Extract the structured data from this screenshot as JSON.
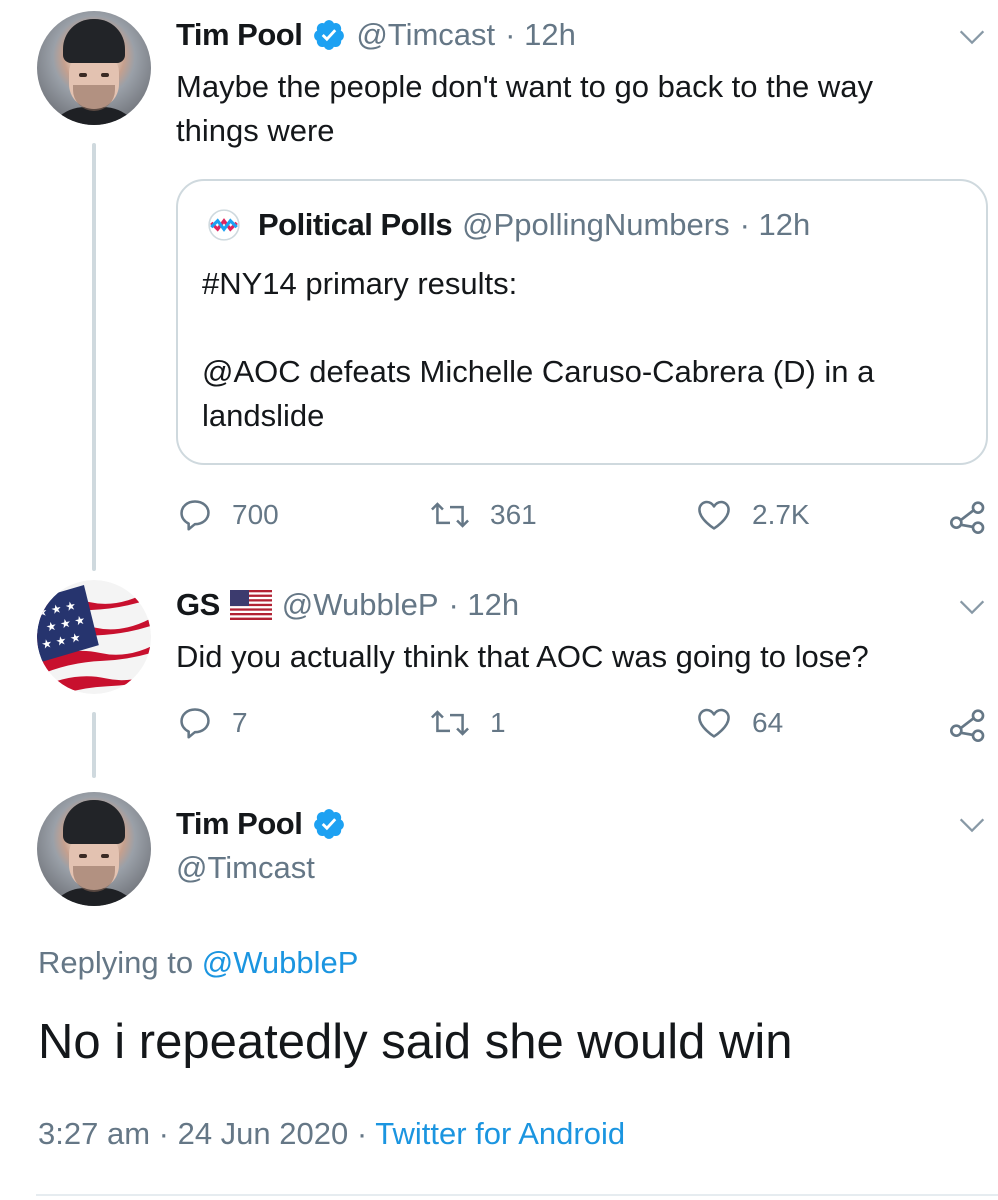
{
  "tweet1": {
    "name": "Tim Pool",
    "handle": "@Timcast",
    "time": "· 12h",
    "text_line1": "Maybe the people don't want to go back to the way",
    "text_line2": "things were",
    "quote": {
      "name": "Political Polls",
      "handle": "@PpollingNumbers",
      "time": "· 12h",
      "line1": "#NY14 primary results:",
      "line2": "@AOC defeats Michelle Caruso-Cabrera (D) in a",
      "line3": "landslide"
    },
    "replies": "700",
    "retweets": "361",
    "likes": "2.7K"
  },
  "tweet2": {
    "name": "GS",
    "handle": "@WubbleP",
    "time": "· 12h",
    "text": "Did you actually think that AOC was going to lose?",
    "replies": "7",
    "retweets": "1",
    "likes": "64"
  },
  "tweet3": {
    "name": "Tim Pool",
    "handle": "@Timcast",
    "replying_prefix": "Replying to",
    "replying_to": "@WubbleP",
    "text": "No i repeatedly said she would win",
    "time": "3:27 am",
    "date": "· 24 Jun 2020 ·",
    "source": "Twitter for Android"
  },
  "colors": {
    "text": "#14171a",
    "muted": "#657786",
    "link": "#1b95e0",
    "verified": "#1da1f2",
    "border": "#cfd9de"
  },
  "icons": {
    "verified": "verified-badge-icon",
    "chevron": "chevron-down-icon",
    "reply": "reply-icon",
    "retweet": "retweet-icon",
    "like": "heart-icon",
    "share": "share-icon"
  }
}
